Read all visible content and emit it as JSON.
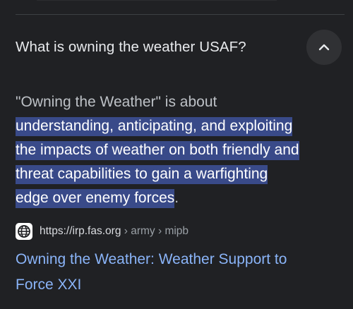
{
  "question": {
    "text": "What is owning the weather USAF?",
    "toggle_icon": "chevron-up-icon"
  },
  "answer": {
    "lead": "\"Owning the Weather\" is about",
    "highlighted_lines": [
      "understanding, anticipating, and exploiting",
      "the impacts of weather on both friendly and",
      "threat capabilities to gain a warfighting",
      "edge over enemy forces"
    ],
    "tail": "."
  },
  "source": {
    "icon": "globe-icon",
    "domain": "https://irp.fas.org",
    "breadcrumb": " › army › mipb"
  },
  "result": {
    "title": "Owning the Weather: Weather Support to Force XXI"
  },
  "colors": {
    "background": "#202124",
    "highlight": "#394a89",
    "link": "#8ab4f8"
  }
}
